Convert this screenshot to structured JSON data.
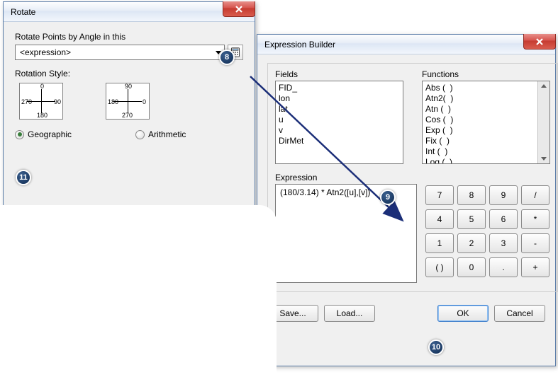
{
  "rotate": {
    "title": "Rotate",
    "angle_label": "Rotate Points by Angle in this",
    "expression_placeholder": "<expression>",
    "style_label": "Rotation Style:",
    "diagram_geo": {
      "n": "0",
      "e": "90",
      "s": "180",
      "w": "270"
    },
    "diagram_arith": {
      "n": "90",
      "e": "0",
      "s": "270",
      "w": "180"
    },
    "radio_geo": "Geographic",
    "radio_arith": "Arithmetic"
  },
  "expr": {
    "title": "Expression Builder",
    "fields_label": "Fields",
    "functions_label": "Functions",
    "fields": [
      "FID_",
      "lon",
      "lat",
      "u",
      "v",
      "",
      "DirMet"
    ],
    "functions": [
      "Abs (  )",
      "Atn2(  )",
      "Atn (  )",
      "Cos (  )",
      "Exp (  )",
      "Fix (  )",
      "Int (  )",
      "Log (  )"
    ],
    "expression_label": "Expression",
    "expression_value": "(180/3.14) * Atn2([u],[v])",
    "keypad": [
      "7",
      "8",
      "9",
      "/",
      "4",
      "5",
      "6",
      "*",
      "1",
      "2",
      "3",
      "-",
      "( )",
      "0",
      ".",
      "+"
    ],
    "save_label": "Save...",
    "load_label": "Load...",
    "ok_label": "OK",
    "cancel_label": "Cancel"
  },
  "badges": {
    "b8": "8",
    "b9": "9",
    "b10": "10",
    "b11": "11"
  }
}
